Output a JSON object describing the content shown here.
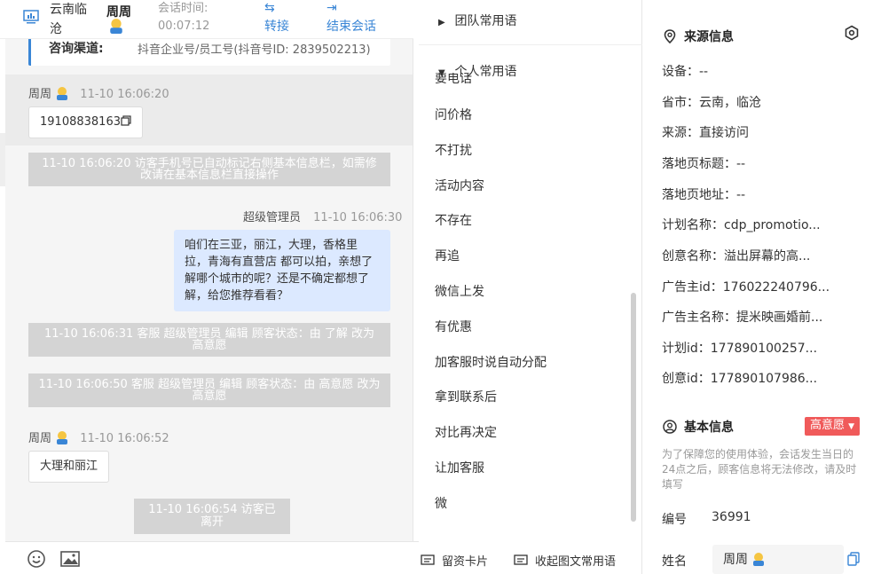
{
  "header": {
    "location": "云南临沧",
    "visitor_name": "周周",
    "session_time_label": "会话时间:",
    "session_time_value": "00:07:12",
    "transfer_label": "转接",
    "end_label": "结束会话"
  },
  "channel": {
    "label": "咨询渠道:",
    "value": "抖音企业号/员工号(抖音号ID: 2839502213)"
  },
  "messages": {
    "m1_name": "周周",
    "m1_time": "11-10 16:06:20",
    "m1_text": "19108838163",
    "sys1": "11-10 16:06:20 访客手机号已自动标记右侧基本信息栏，如需修改请在基本信息栏直接操作",
    "m2_name": "超级管理员",
    "m2_time": "11-10 16:06:30",
    "m2_text": "咱们在三亚，丽江，大理，香格里拉，青海有直营店 都可以拍，亲想了解哪个城市的呢？还是不确定都想了解，给您推荐看看？",
    "sys2": "11-10 16:06:31 客服 超级管理员 编辑 顾客状态：由 了解 改为 高意愿",
    "sys3": "11-10 16:06:50 客服 超级管理员 编辑 顾客状态：由 高意愿 改为 高意愿",
    "m3_name": "周周",
    "m3_time": "11-10 16:06:52",
    "m3_text": "大理和丽江",
    "sys4": "11-10 16:06:54 访客已离开"
  },
  "phrases": {
    "team_group": "团队常用语",
    "personal_group": "个人常用语",
    "clipped_item": "要电话",
    "items": [
      "问价格",
      "不打扰",
      "活动内容",
      "不存在",
      "再追",
      "微信上发",
      "有优惠",
      "加客服时说自动分配",
      "拿到联系后",
      "对比再决定",
      "让加客服",
      "微"
    ],
    "footer_card": "留资卡片",
    "footer_collapse": "收起图文常用语"
  },
  "source_info": {
    "title": "来源信息",
    "rows": [
      "设备：--",
      "省市：云南，临沧",
      "来源：直接访问",
      "落地页标题：--",
      "落地页地址：--",
      "计划名称：cdp_promotio...",
      "创意名称：溢出屏幕的高...",
      "广告主id：176022240796...",
      "广告主名称：提米映画婚前...",
      "计划id：177890100257...",
      "创意id：177890107986..."
    ]
  },
  "basic_info": {
    "title": "基本信息",
    "status_tag": "高意愿",
    "notice": "为了保障您的使用体验，会话发生当日的24点之后，顾客信息将无法修改，请及时填写",
    "number_label": "编号",
    "number_value": "36991",
    "name_label": "姓名",
    "name_value": "周周"
  },
  "colors": {
    "accent": "#3a86d6",
    "system_msg_bg": "#d4d4d4",
    "agent_bubble_bg": "#dce9ff",
    "status_red": "#f05a5a"
  },
  "icons": [
    "monitor-icon",
    "avatar-icon",
    "transfer-icon",
    "exit-icon",
    "copy-icon",
    "emoji-icon",
    "image-icon",
    "location-pin-icon",
    "settings-hex-icon",
    "user-circle-icon",
    "card-icon",
    "collapse-icon",
    "caret-right-icon",
    "caret-down-icon"
  ]
}
